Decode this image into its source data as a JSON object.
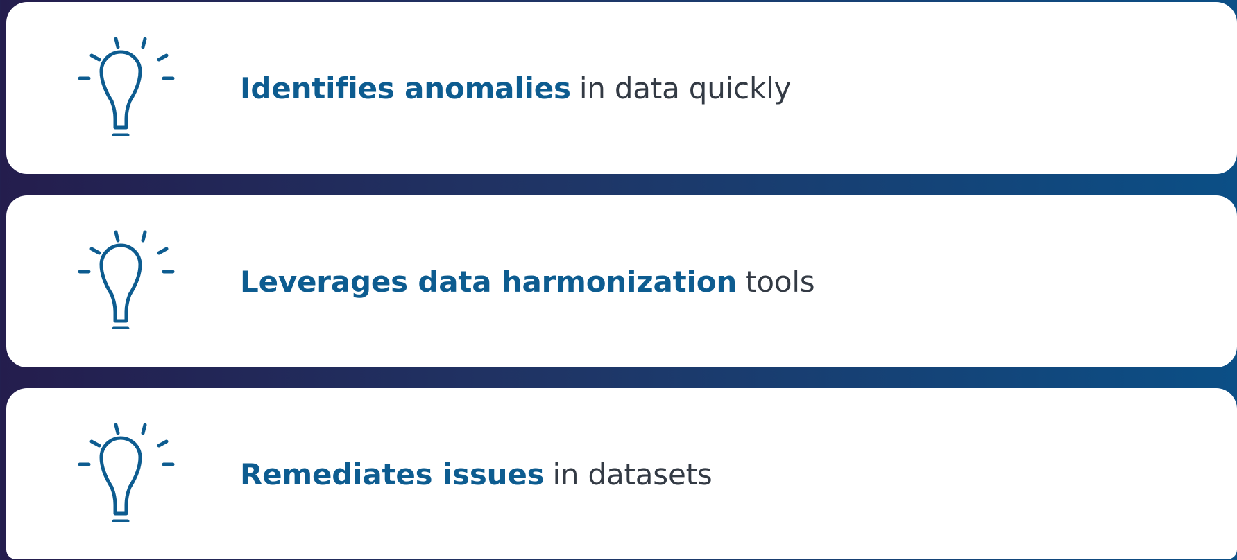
{
  "colors": {
    "accent": "#0d5c90",
    "text": "#333a44",
    "card_bg": "#ffffff",
    "bg_gradient": [
      "#241d4d",
      "#1f3566",
      "#0b4f86"
    ]
  },
  "items": [
    {
      "icon": "lightbulb-icon",
      "bold": "Identifies anomalies",
      "rest": "in data quickly"
    },
    {
      "icon": "lightbulb-icon",
      "bold": "Leverages data harmonization",
      "rest": "tools"
    },
    {
      "icon": "lightbulb-icon",
      "bold": "Remediates issues",
      "rest": "in datasets"
    }
  ]
}
